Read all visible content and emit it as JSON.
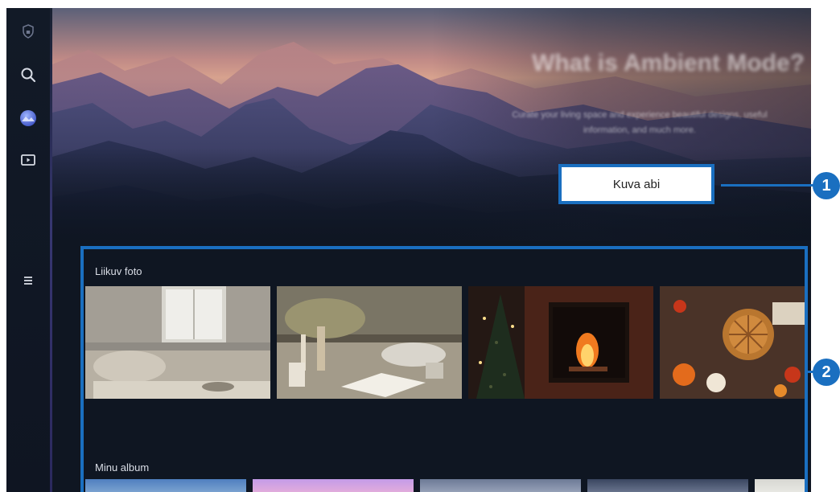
{
  "sidebar": {
    "items": [
      {
        "icon": "shield-lock-icon"
      },
      {
        "icon": "search-icon"
      },
      {
        "icon": "ambient-mode-icon"
      },
      {
        "icon": "media-icon"
      },
      {
        "icon": "menu-icon"
      }
    ]
  },
  "hero": {
    "title": "What is Ambient Mode?",
    "subtitle": "Curate your living space and experience beautiful designs, useful information, and much more.",
    "help_button_label": "Kuva abi"
  },
  "sections": {
    "motion_photo_title": "Liikuv foto",
    "my_album_title": "Minu album"
  },
  "callouts": {
    "one": "1",
    "two": "2"
  },
  "colors": {
    "accent": "#1a6fc0",
    "background": "#0f1622"
  }
}
